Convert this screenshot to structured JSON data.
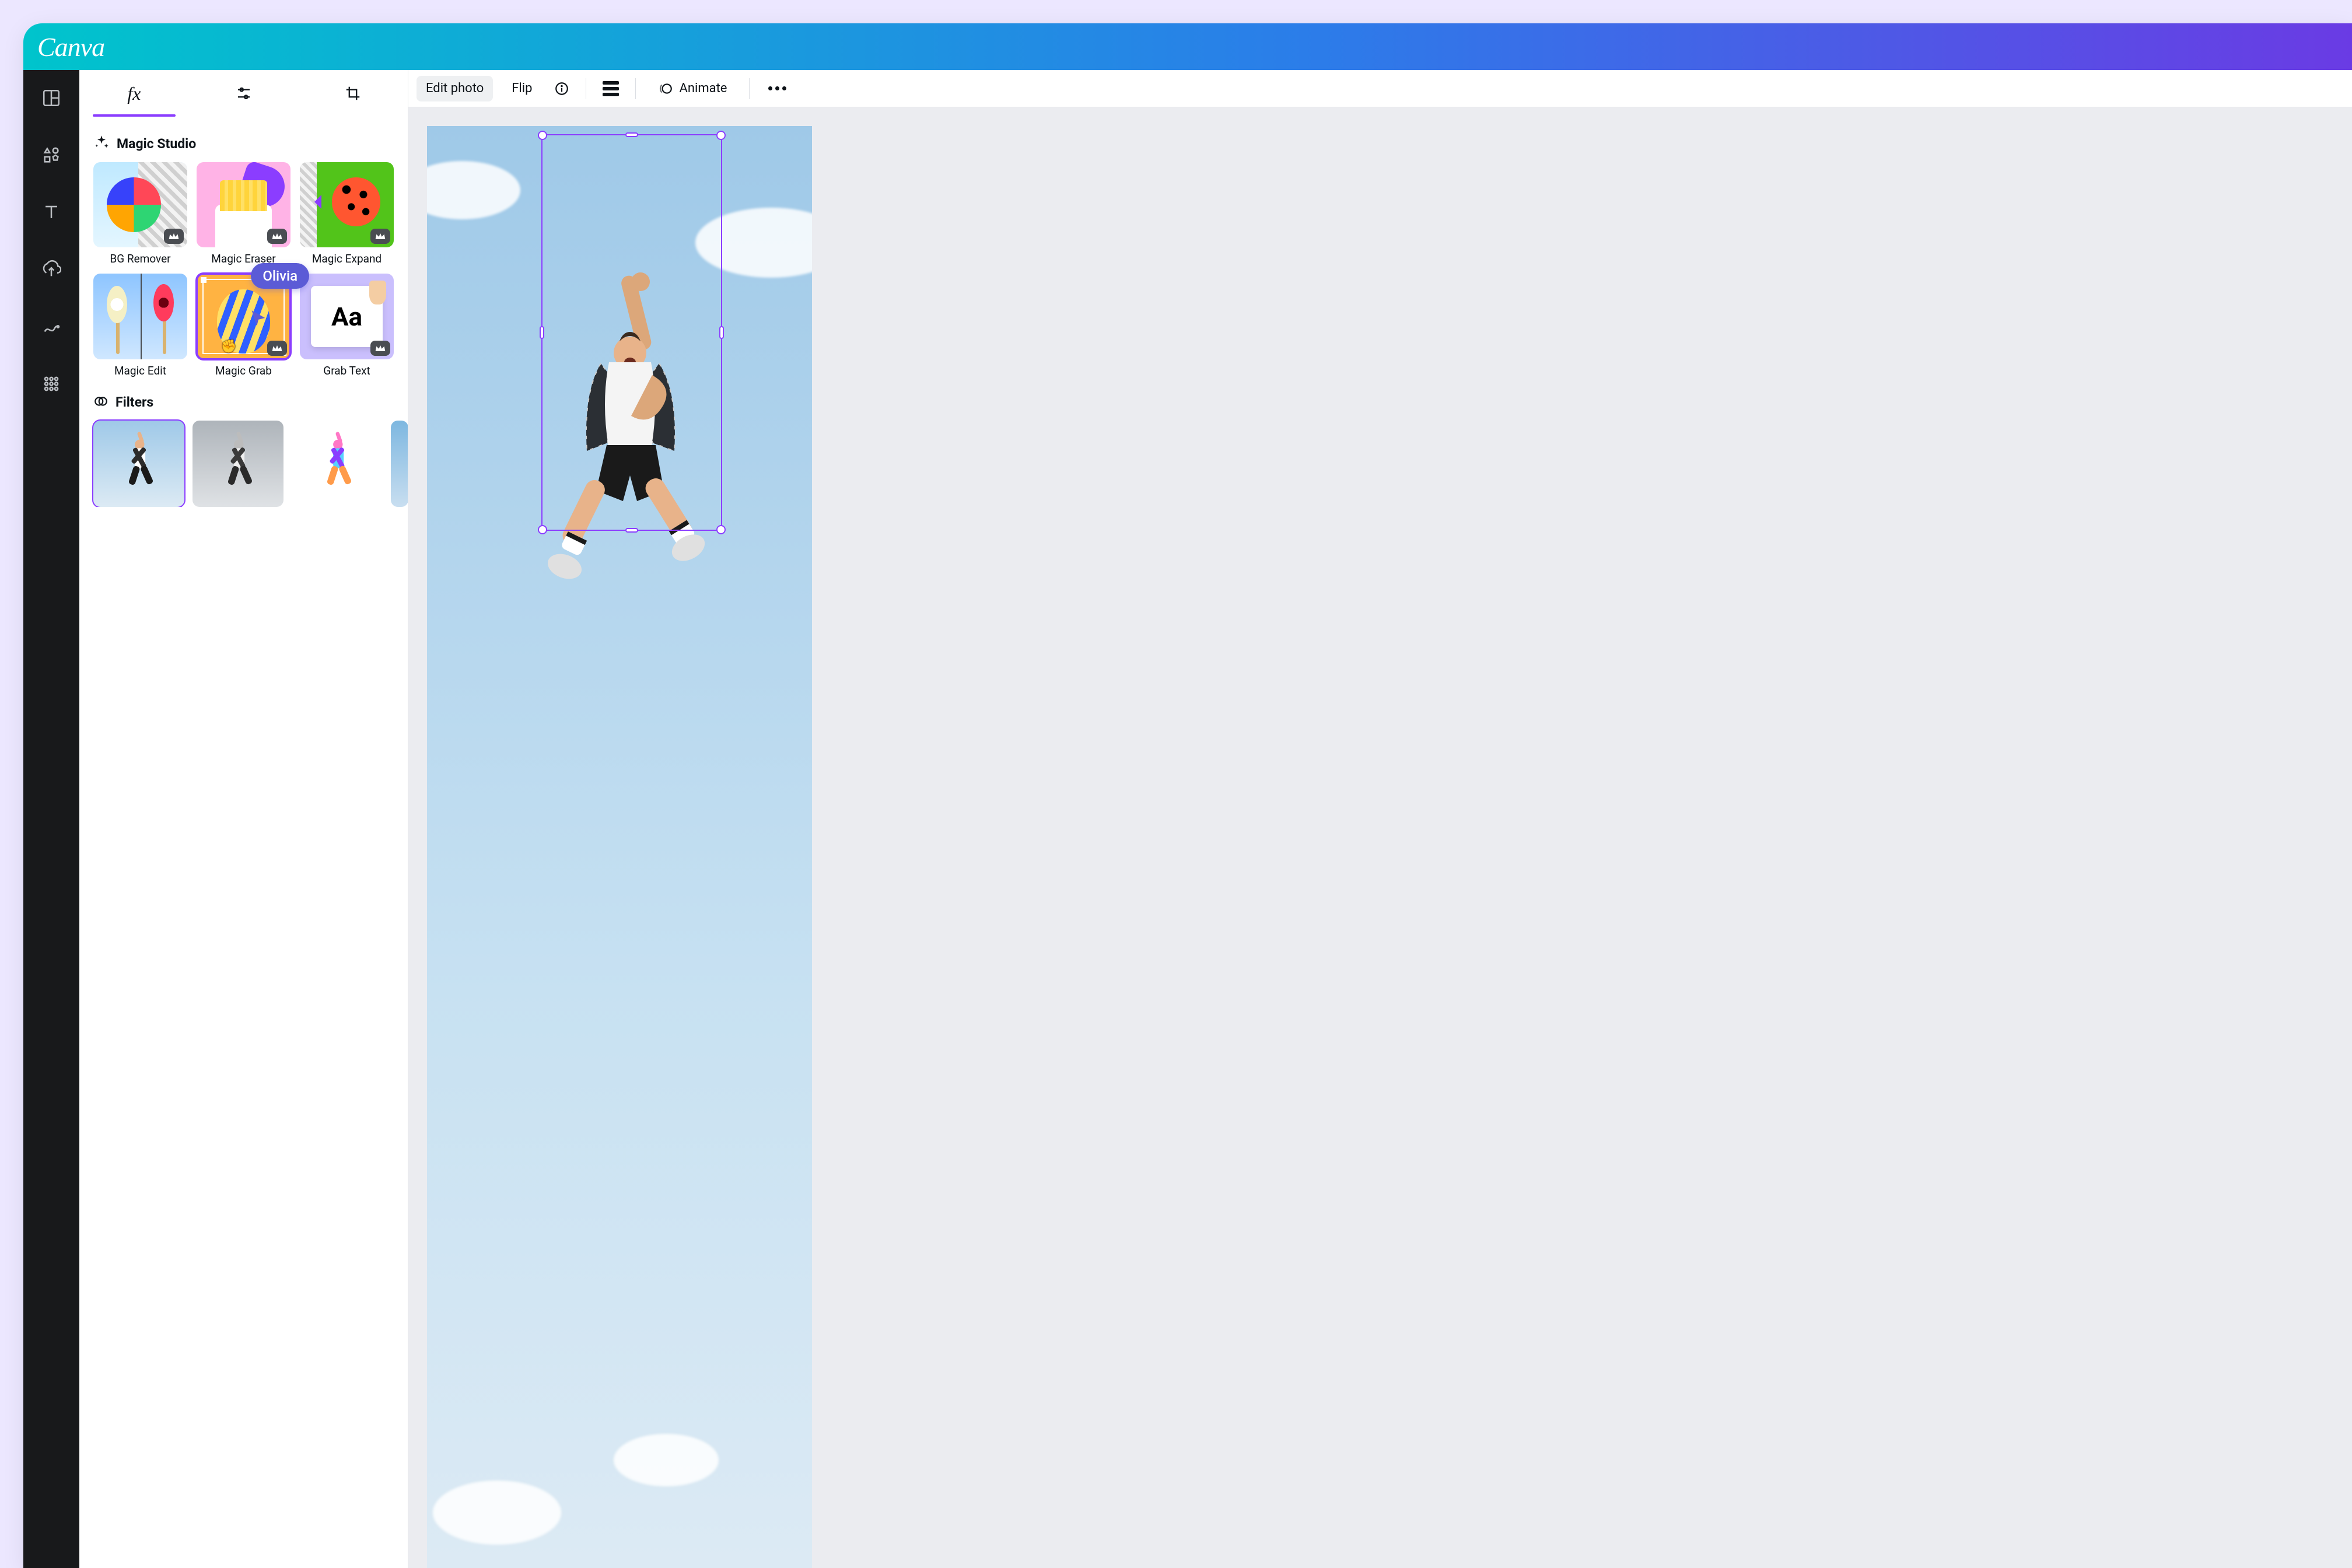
{
  "app": {
    "brand": "Canva"
  },
  "rail": {
    "items": [
      {
        "name": "templates-icon"
      },
      {
        "name": "elements-icon"
      },
      {
        "name": "text-icon"
      },
      {
        "name": "uploads-icon"
      },
      {
        "name": "draw-icon"
      },
      {
        "name": "apps-grid-icon"
      }
    ]
  },
  "side_panel": {
    "tabs": [
      {
        "name": "effects-tab",
        "label": "fx",
        "active": true
      },
      {
        "name": "adjust-tab"
      },
      {
        "name": "crop-tab"
      }
    ],
    "sections": {
      "magic_studio": {
        "title": "Magic Studio",
        "items": [
          {
            "label": "BG Remover",
            "premium": true,
            "selected": false,
            "name": "bg-remover"
          },
          {
            "label": "Magic Eraser",
            "premium": true,
            "selected": false,
            "name": "magic-eraser"
          },
          {
            "label": "Magic Expand",
            "premium": true,
            "selected": false,
            "name": "magic-expand"
          },
          {
            "label": "Magic Edit",
            "premium": false,
            "selected": false,
            "name": "magic-edit"
          },
          {
            "label": "Magic Grab",
            "premium": true,
            "selected": true,
            "name": "magic-grab"
          },
          {
            "label": "Grab Text",
            "premium": true,
            "selected": false,
            "name": "grab-text"
          }
        ]
      },
      "filters": {
        "title": "Filters",
        "items": [
          {
            "name": "filter-none",
            "selected": true
          },
          {
            "name": "filter-grayscale",
            "selected": false
          },
          {
            "name": "filter-vivid",
            "selected": false
          },
          {
            "name": "filter-cool",
            "selected": false
          }
        ]
      }
    },
    "collaborator": {
      "name": "Olivia",
      "color": "#5b5bd6"
    }
  },
  "context_toolbar": {
    "edit_photo": "Edit photo",
    "flip": "Flip",
    "animate": "Animate"
  },
  "canvas": {
    "selection": {
      "color": "#8b3dff"
    }
  }
}
